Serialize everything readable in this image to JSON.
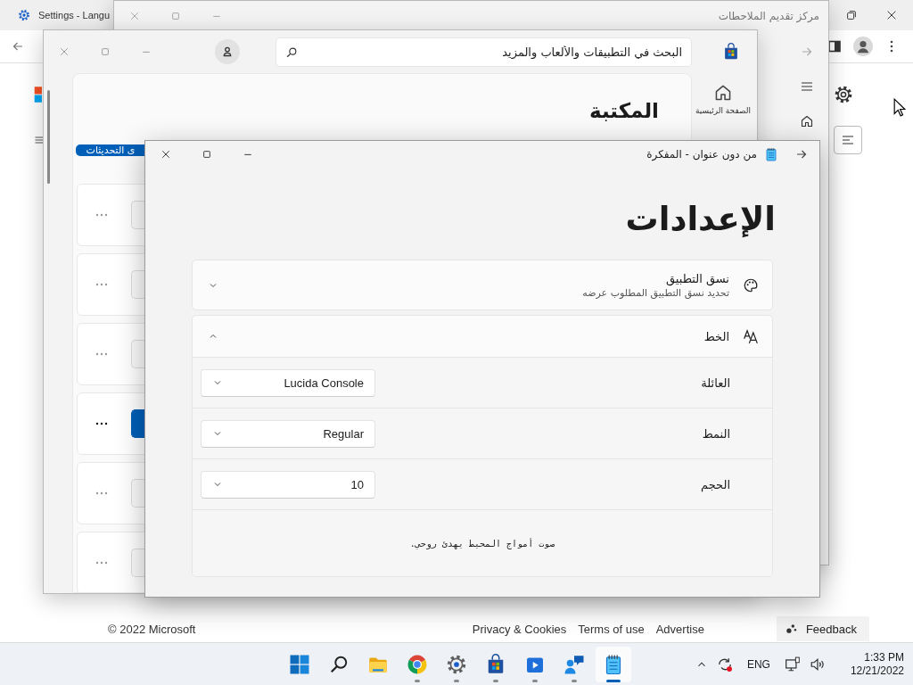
{
  "browser": {
    "tab": {
      "title": "Settings - Langu"
    },
    "footer": {
      "copyright": "© 2022 Microsoft",
      "privacy_link": "Privacy & Cookies",
      "terms_link": "Terms of use",
      "advertise_link": "Advertise",
      "feedback": "Feedback"
    }
  },
  "feedback_hub": {
    "title": "مركز تقديم الملاحطات"
  },
  "store": {
    "search": {
      "placeholder": "البحث في التطبيقات والألعاب والمزيد"
    },
    "nav": [
      {
        "label": "الصفحة الرئيسية"
      }
    ],
    "heading": "المكتبة",
    "update_button": "ى التحديثات",
    "items": [
      {
        "primary": false
      },
      {
        "primary": false
      },
      {
        "primary": false
      },
      {
        "primary": true
      },
      {
        "primary": false
      },
      {
        "primary": false
      }
    ]
  },
  "notepad": {
    "title": "من دون عنوان - المفكرة",
    "heading": "الإعدادات",
    "sections": [
      {
        "kind": "option",
        "title": "نسق التطبيق",
        "description": "تحديد نسق التطبيق المطلوب عرضه",
        "expanded": false
      },
      {
        "kind": "font",
        "title": "الخط",
        "expanded": true,
        "fields": [
          {
            "label": "العائلة",
            "value": "Lucida Console"
          },
          {
            "label": "النمط",
            "value": "Regular"
          },
          {
            "label": "الحجم",
            "value": "10"
          }
        ],
        "preview": "صوت أمواج المحيط يهدئ روحي."
      }
    ]
  },
  "taskbar": {
    "apps": [
      {
        "kind": "start",
        "running": false,
        "active": false
      },
      {
        "kind": "search",
        "running": false,
        "active": false
      },
      {
        "kind": "explorer",
        "running": false,
        "active": false
      },
      {
        "kind": "chrome",
        "running": true,
        "active": false
      },
      {
        "kind": "settings",
        "running": true,
        "active": false
      },
      {
        "kind": "store",
        "running": true,
        "active": false
      },
      {
        "kind": "media",
        "running": true,
        "active": false
      },
      {
        "kind": "people",
        "running": true,
        "active": false
      },
      {
        "kind": "notepad",
        "running": true,
        "active": true
      }
    ],
    "language": "ENG",
    "time": "1:33 PM",
    "date": "12/21/2022"
  }
}
